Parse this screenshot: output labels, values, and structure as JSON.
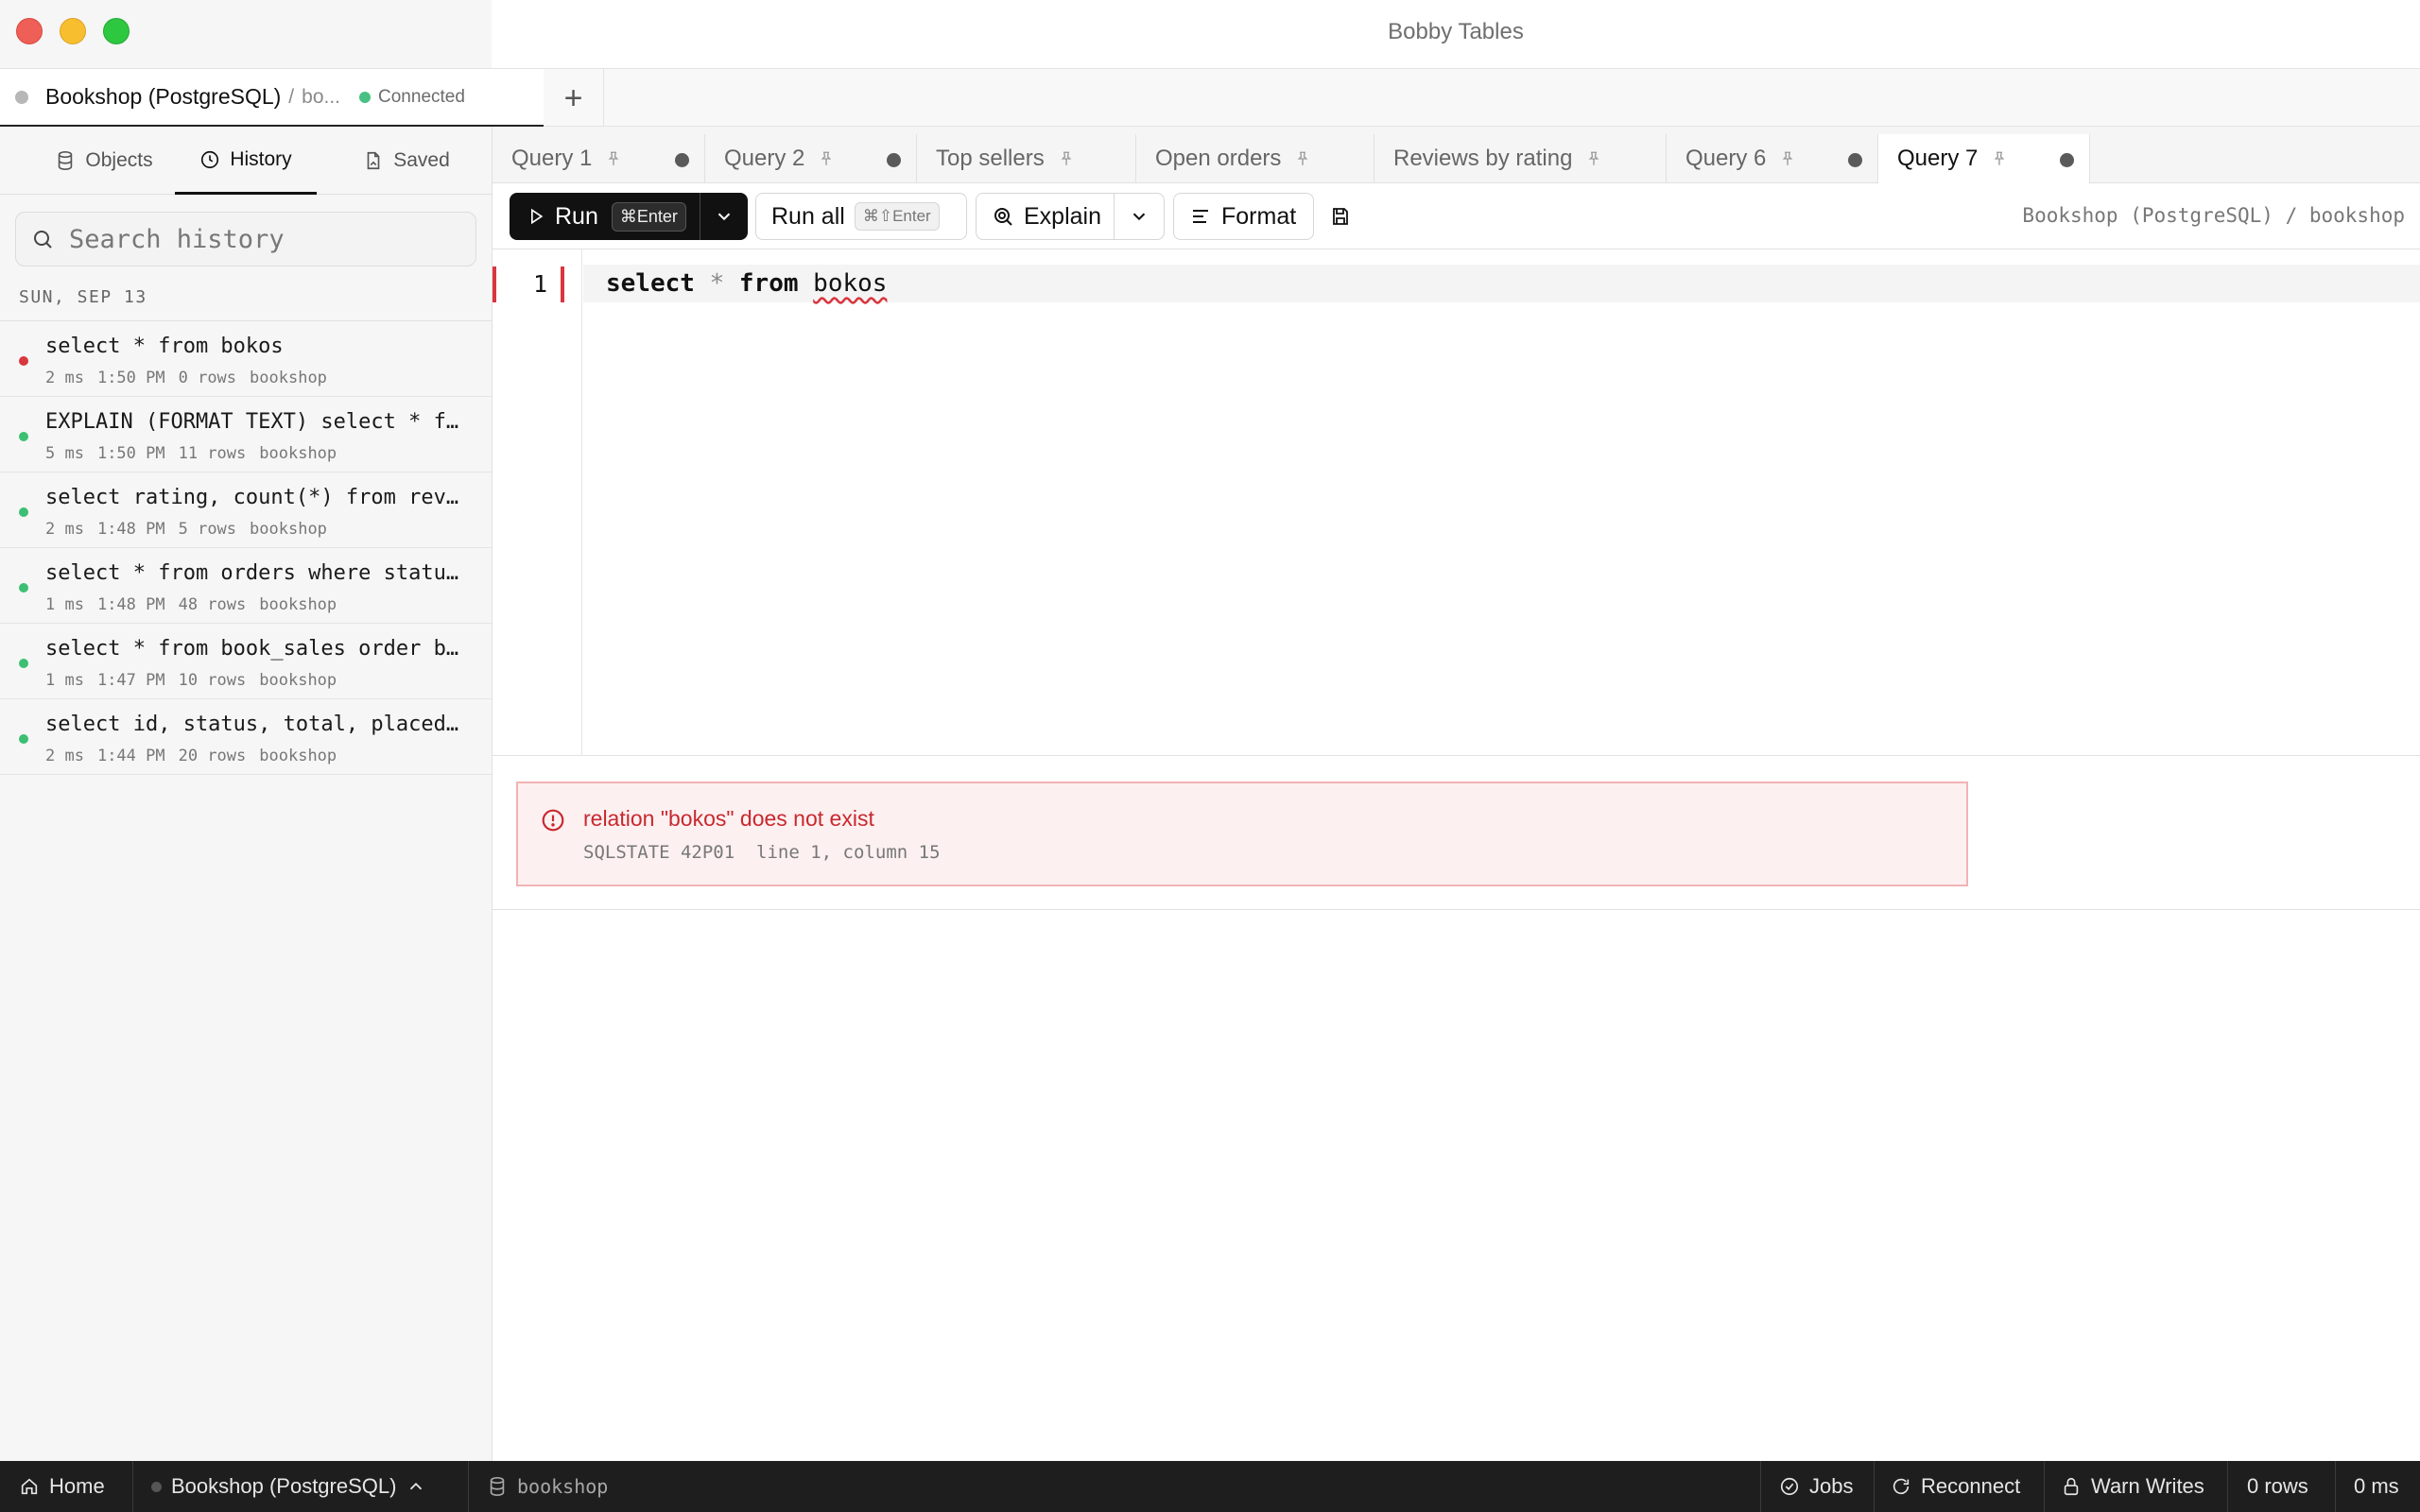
{
  "window": {
    "title": "Bobby Tables"
  },
  "connection_tab": {
    "name": "Bookshop (PostgreSQL)",
    "separator": "/",
    "database": "bo...",
    "status": "Connected",
    "add_label": "+"
  },
  "sidebar": {
    "tabs": [
      {
        "label": "Objects",
        "icon": "database-icon"
      },
      {
        "label": "History",
        "icon": "clock-icon",
        "active": true
      },
      {
        "label": "Saved",
        "icon": "saved-file-icon"
      }
    ],
    "search_placeholder": "Search history",
    "date_header": "SUN, SEP 13",
    "history": [
      {
        "query": "select * from bokos",
        "duration": "2 ms",
        "time": "1:50 PM",
        "rows": "0 rows",
        "db": "bookshop",
        "status": "error"
      },
      {
        "query": "EXPLAIN (FORMAT TEXT) select * f…",
        "duration": "5 ms",
        "time": "1:50 PM",
        "rows": "11 rows",
        "db": "bookshop",
        "status": "ok"
      },
      {
        "query": "select rating, count(*) from rev…",
        "duration": "2 ms",
        "time": "1:48 PM",
        "rows": "5 rows",
        "db": "bookshop",
        "status": "ok"
      },
      {
        "query": "select * from orders where statu…",
        "duration": "1 ms",
        "time": "1:48 PM",
        "rows": "48 rows",
        "db": "bookshop",
        "status": "ok"
      },
      {
        "query": "select * from book_sales order b…",
        "duration": "1 ms",
        "time": "1:47 PM",
        "rows": "10 rows",
        "db": "bookshop",
        "status": "ok"
      },
      {
        "query": "select id, status, total, placed…",
        "duration": "2 ms",
        "time": "1:44 PM",
        "rows": "20 rows",
        "db": "bookshop",
        "status": "ok"
      }
    ]
  },
  "query_tabs": [
    {
      "label": "Query 1",
      "modified": true
    },
    {
      "label": "Query 2",
      "modified": true
    },
    {
      "label": "Top sellers",
      "modified": false
    },
    {
      "label": "Open orders",
      "modified": false
    },
    {
      "label": "Reviews by rating",
      "modified": false
    },
    {
      "label": "Query 6",
      "modified": true
    },
    {
      "label": "Query 7",
      "modified": true,
      "active": true
    }
  ],
  "toolbar": {
    "run_label": "Run",
    "run_shortcut": "⌘Enter",
    "run_all_label": "Run all",
    "run_all_shortcut": "⌘⇧Enter",
    "explain_label": "Explain",
    "format_label": "Format",
    "connection_path": "Bookshop (PostgreSQL) / bookshop"
  },
  "editor": {
    "line_number": "1",
    "tokens": {
      "kw1": "select",
      "op": "*",
      "kw2": "from",
      "ident": "bokos"
    }
  },
  "error": {
    "message": "relation \"bokos\" does not exist",
    "sqlstate": "SQLSTATE 42P01",
    "location": "line 1, column 15"
  },
  "statusbar": {
    "home": "Home",
    "connection": "Bookshop (PostgreSQL)",
    "database": "bookshop",
    "jobs": "Jobs",
    "reconnect": "Reconnect",
    "warn_writes": "Warn Writes",
    "rows": "0 rows",
    "time": "0 ms"
  }
}
